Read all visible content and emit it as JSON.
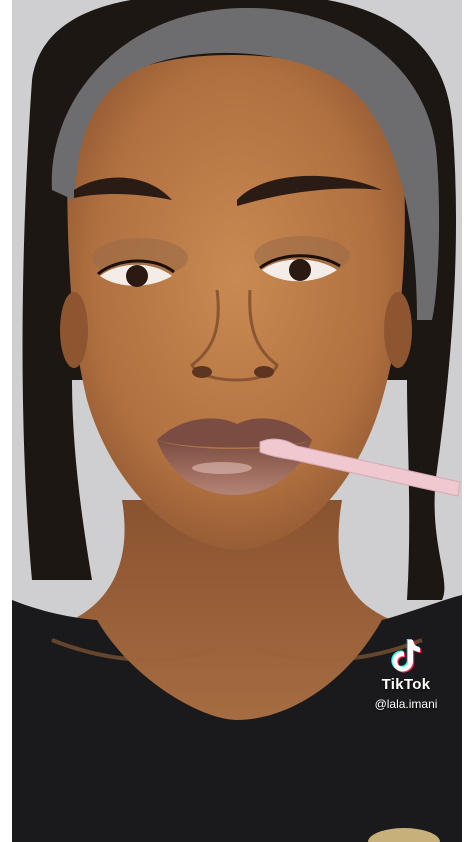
{
  "watermark": {
    "brand": "TikTok",
    "handle": "@lala.imani",
    "logo_icon": "tiktok-note-icon"
  },
  "video": {
    "description_icon": "video-frame"
  },
  "colors": {
    "skin": "#b97a45",
    "background": "#cfcfd1",
    "shirt": "#1a1a1c",
    "headband": "#6d6d70",
    "lip": "#8c5a4a",
    "applicator": "#f0c8cf"
  }
}
